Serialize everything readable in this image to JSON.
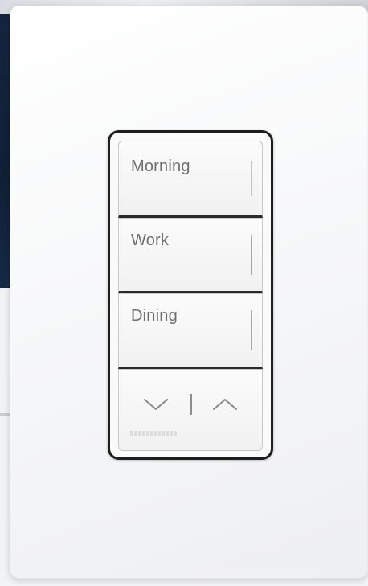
{
  "keypad": {
    "buttons": [
      {
        "label": "Morning",
        "led": "off"
      },
      {
        "label": "Work",
        "led": "off"
      },
      {
        "label": "Dining",
        "led": "off"
      }
    ],
    "raise_lower": {
      "lower_icon": "chevron-down-icon",
      "raise_icon": "chevron-up-icon"
    }
  },
  "colors": {
    "plate": "#f7f8f9",
    "frame": "#1e1e1e",
    "label_text": "#6e6e6e"
  }
}
